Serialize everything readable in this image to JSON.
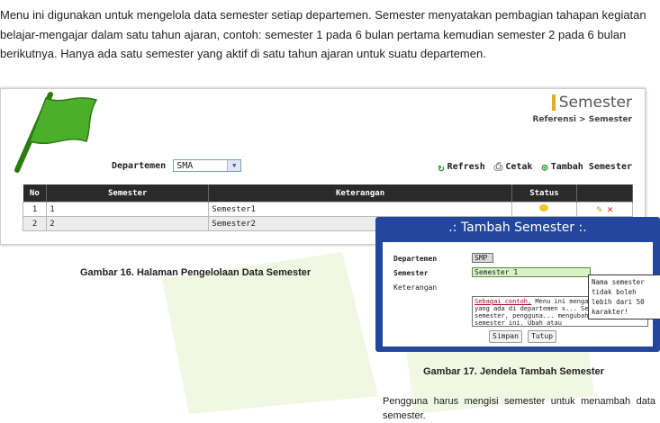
{
  "intro": "Menu ini digunakan untuk mengelola data semester setiap departemen. Semester menyatakan pembagian tahapan kegiatan belajar-mengajar dalam satu tahun ajaran, contoh: semester 1 pada 6 bulan pertama kemudian semester 2 pada 6 bulan berikutnya. Hanya ada satu semester yang aktif di satu tahun ajaran untuk suatu departemen.",
  "page": {
    "title": "Semester",
    "breadcrumb": "Referensi > Semester",
    "departemen_label": "Departemen",
    "departemen_value": "SMA",
    "toolbar": {
      "refresh": "Refresh",
      "cetak": "Cetak",
      "tambah": "Tambah Semester"
    },
    "table": {
      "headers": [
        "No",
        "Semester",
        "Keterangan",
        "Status",
        ""
      ],
      "rows": [
        {
          "no": "1",
          "semester": "1",
          "keterangan": "Semester1"
        },
        {
          "no": "2",
          "semester": "2",
          "keterangan": "Semester2"
        }
      ]
    },
    "colors": {
      "header_bg": "#2a2a2a",
      "flag": "#4caf2a"
    }
  },
  "caption16": "Gambar 16. Halaman Pengelolaan Data Semester",
  "dialog": {
    "title": ".: Tambah Semester :.",
    "departemen_label": "Departemen",
    "departemen_value": "SMP",
    "semester_label": "Semester",
    "semester_value": "Semester 1",
    "keterangan_label": "Keterangan",
    "keterangan_tip": "Sebagai contoh,",
    "keterangan_text": " Menu ini mengatur semester yang ada di departemen s... Setiap pergantian semester, pengguna... mengubah status aktif semester ini. Ubah atau",
    "tooltip": "Nama semester tidak boleh lebih dari 50 karakter!",
    "simpan": "Simpan",
    "tutup": "Tutup",
    "colors": {
      "frame": "#23479c"
    }
  },
  "caption17": "Gambar 17. Jendela Tambah Semester",
  "body_text": "Pengguna harus mengisi semester untuk menambah data semester."
}
